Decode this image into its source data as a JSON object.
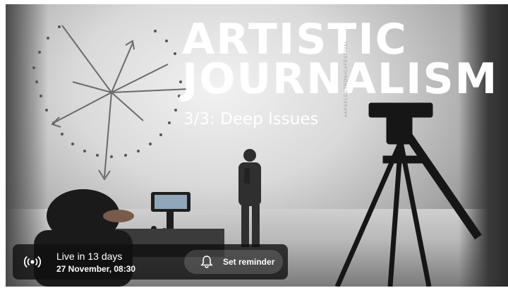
{
  "thumbnail": {
    "title_line1": "ARTISTIC",
    "title_line2": "JOURNALISM",
    "subtitle": "3/3: Deep Issues",
    "vertical_text": "#ARSELECTRONICAFESTIVAL"
  },
  "live_banner": {
    "status": "Live in 13 days",
    "datetime": "27 November, 08:30",
    "live_icon": "live-broadcast-icon",
    "reminder_label": "Set reminder",
    "reminder_icon": "bell-icon"
  },
  "colors": {
    "banner_bg": "#0f0f0f",
    "text": "#ffffff"
  }
}
